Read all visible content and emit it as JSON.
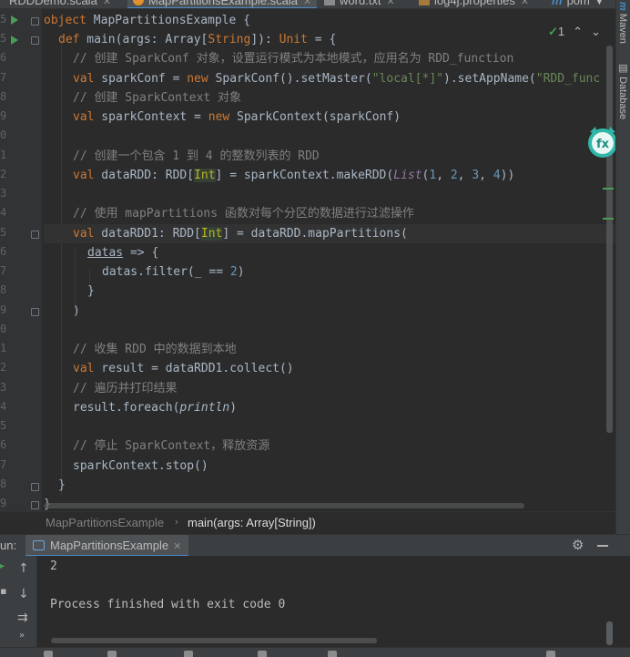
{
  "tabs": [
    {
      "label": "RDDDemo.scala",
      "active": false
    },
    {
      "label": "MapPartitionsExample.scala",
      "active": true
    },
    {
      "label": "word.txt",
      "active": false
    },
    {
      "label": "log4j.properties",
      "active": false
    },
    {
      "label": "pom",
      "active": false
    }
  ],
  "tool_windows": {
    "maven": "Maven",
    "database": "Database"
  },
  "editor": {
    "inspection_count": "1",
    "line_number_digits": [
      "5",
      "5",
      "6",
      "7",
      "8",
      "9",
      "0",
      "1",
      "2",
      "3",
      "4",
      "5",
      "6",
      "7",
      "8",
      "9",
      "0",
      "1",
      "2",
      "3",
      "4",
      "5",
      "6",
      "7",
      "8",
      "9"
    ],
    "code": {
      "object_kw": "object",
      "object_name": " MapPartitionsExample {",
      "def_kw": "def",
      "main_sig": " main(args: Array[",
      "string_ty": "String",
      "main_sig2": "]): ",
      "unit_ty": "Unit",
      "main_sig3": " = {",
      "c1": "// 创建 SparkConf 对象，设置运行模式为本地模式，应用名为 RDD_function",
      "val": "val",
      "sc_decl": " sparkConf = ",
      "new": "new",
      "sc_call": " SparkConf().setMaster(",
      "sc_str1": "\"local[*]\"",
      "sc_call2": ").setAppName(",
      "sc_str2": "\"RDD_func",
      "c2": "// 创建 SparkContext 对象",
      "ctx_decl": " sparkContext = ",
      "ctx_call": " SparkContext(sparkConf)",
      "c3": "// 创建一个包含 1 到 4 的整数列表的 RDD",
      "rdd_decl": " dataRDD: RDD[",
      "int_ty": "Int",
      "rdd_call": "] = sparkContext.makeRDD(",
      "list_fn": "List",
      "rdd_args_open": "(",
      "n1": "1",
      "n2": "2",
      "n3": "3",
      "n4": "4",
      "comma": ", ",
      "rdd_close": "))",
      "c4": "// 使用 mapPartitions 函数对每个分区的数据进行过滤操作",
      "rdd1_decl": " dataRDD1: RDD[",
      "rdd1_call": "] = dataRDD.mapPartitions(",
      "datas": "datas",
      "arrow": " => {",
      "filter": "datas.filter(_ == ",
      "filter_close": ")",
      "close_brace": "}",
      "close_paren": ")",
      "c5": "// 收集 RDD 中的数据到本地",
      "res_decl": " result = dataRDD1.collect()",
      "c6": "// 遍历并打印结果",
      "foreach": "result.foreach(",
      "println": "println",
      "foreach_close": ")",
      "c7": "// 停止 SparkContext，释放资源",
      "stop": "sparkContext.stop()"
    }
  },
  "breadcrumb": {
    "object": "MapPartitionsExample",
    "method": "main(args: Array[String])"
  },
  "run": {
    "label": "un:",
    "tab": "MapPartitionsExample",
    "output": [
      "2",
      "Process finished with exit code 0"
    ]
  },
  "colors": {
    "keyword": "#cc7832",
    "string": "#6a8759",
    "number": "#6897bb",
    "comment": "#808080",
    "accent": "#4a88c7",
    "run_green": "#499c54"
  }
}
